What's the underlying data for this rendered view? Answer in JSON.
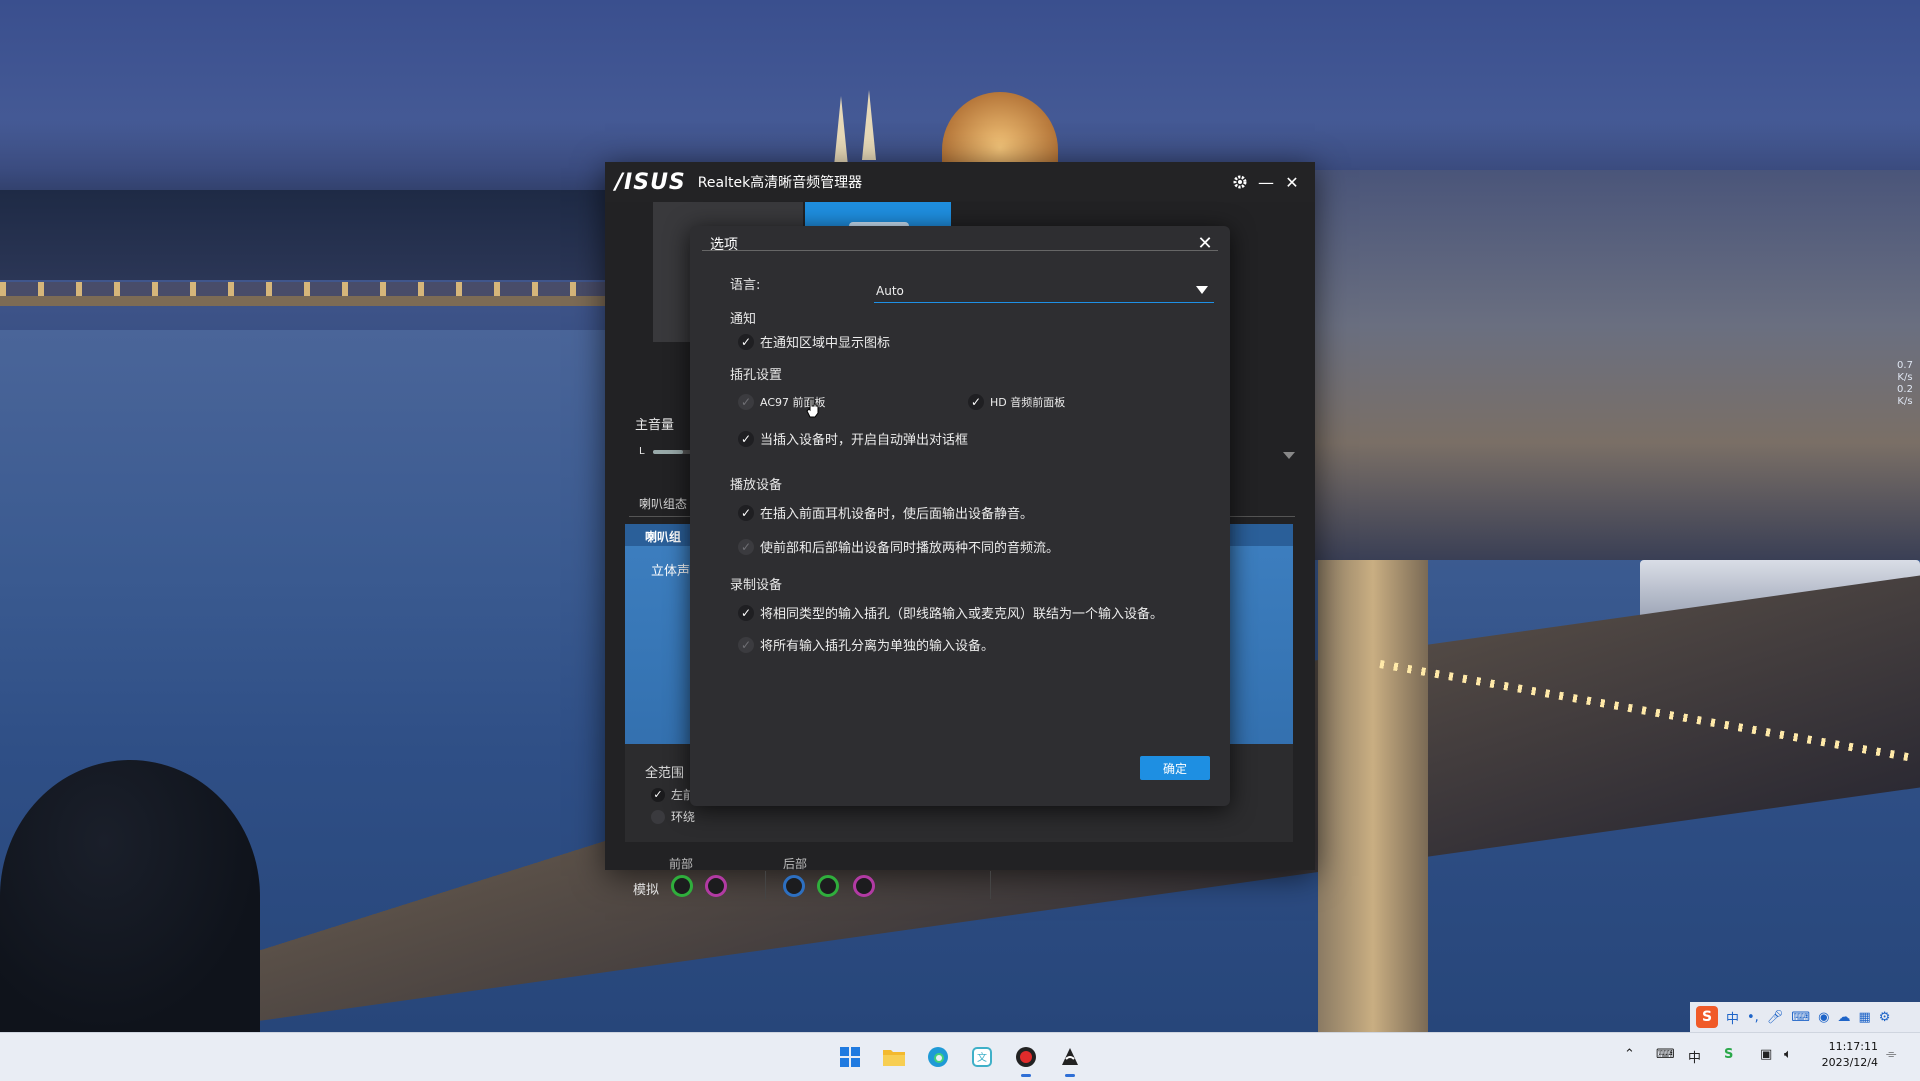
{
  "app": {
    "logo_text": "/ISUS",
    "title": "Realtek高清晰音频管理器",
    "main_volume_label": "主音量",
    "volume_channel": "L",
    "lower_tab": "喇叭组态",
    "blue_panel_header": "喇叭组",
    "blue_panel_sub": "立体声",
    "full_range_label": "全范围",
    "full_range_options": [
      {
        "label": "左前",
        "checked": true
      },
      {
        "label": "环绕",
        "checked": false
      }
    ],
    "front_label": "前部",
    "rear_label": "后部",
    "analog_label": "模拟"
  },
  "dialog": {
    "title": "选项",
    "language_label": "语言:",
    "language_value": "Auto",
    "notify_section": "通知",
    "notify_option": "在通知区域中显示图标",
    "jack_section": "插孔设置",
    "jack_ac97": "AC97 前面板",
    "jack_hd": "HD 音频前面板",
    "jack_popup": "当插入设备时，开启自动弹出对话框",
    "playback_section": "播放设备",
    "playback_mute": "在插入前面耳机设备时，使后面输出设备静音。",
    "playback_dual": "使前部和后部输出设备同时播放两种不同的音频流。",
    "record_section": "录制设备",
    "record_link": "将相同类型的输入插孔（即线路输入或麦克风）联结为一个输入设备。",
    "record_separate": "将所有输入插孔分离为单独的输入设备。",
    "ok_label": "确定",
    "checked": {
      "notify": true,
      "ac97": false,
      "hd": true,
      "popup": true,
      "mute": true,
      "dual": false,
      "link": true,
      "separate": false
    }
  },
  "desktop": {
    "net_speed_up": "0.7",
    "net_speed_up_unit": "K/s",
    "net_speed_down": "0.2",
    "net_speed_down_unit": "K/s"
  },
  "taskbar": {
    "ime_logo": "S",
    "ime_lang": "中",
    "clock_time": "11:17:11",
    "clock_date": "2023/12/4"
  },
  "colors": {
    "accent": "#1e8fe2",
    "jack_green": "#2fae3c",
    "jack_pink": "#b23aa3",
    "jack_blue": "#2d6fc0"
  }
}
